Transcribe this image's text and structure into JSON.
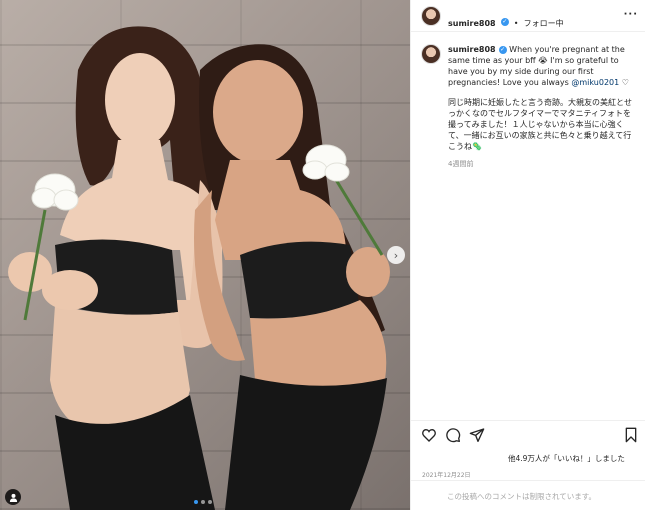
{
  "post": {
    "username": "sumire808",
    "verified_mark": "✓",
    "separator": "•",
    "follow_status": "フォロー中",
    "more_icon": "more-icon",
    "caption_en_part1": "When you're pregnant at the same time as your bff",
    "caption_emoji": "😭",
    "caption_en_part2": "I'm so grateful to have you by my side during our first pregnancies! Love you always",
    "mention": "@miku0201",
    "heart_emoji": "♡",
    "caption_jp": "同じ時期に妊娠したと言う奇跡。大親友の美紅とせっかくなのでセルフタイマーでマタニティフォトを撮ってみました！１人じゃないから本当に心強くて、一緒にお互いの家族と共に色々と乗り越えて行こうね",
    "caption_jp_emoji": "🦠",
    "time_ago": "4週間前",
    "likes_text": "他4.9万人が「いいね！」しました",
    "date": "2021年12月22日",
    "comments_disabled": "この投稿へのコメントは制限されています。"
  },
  "photo": {
    "next_arrow": "›",
    "carousel": {
      "count": 3,
      "active": 0
    },
    "tag_icon": "person-icon"
  },
  "colors": {
    "accent": "#3897f0",
    "text": "#262626",
    "muted": "#8e8e8e",
    "border": "#efefef",
    "mention": "#00376b"
  }
}
